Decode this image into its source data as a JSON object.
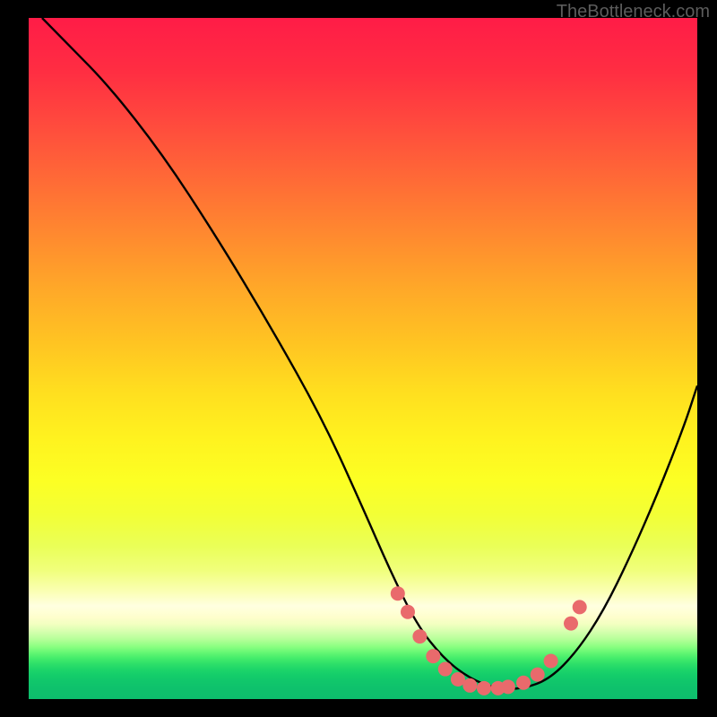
{
  "attribution": "TheBottleneck.com",
  "chart_data": {
    "type": "line",
    "title": "",
    "xlabel": "",
    "ylabel": "",
    "xlim": [
      0,
      100
    ],
    "ylim": [
      0,
      100
    ],
    "grid": false,
    "legend": false,
    "series": [
      {
        "name": "bottleneck-curve",
        "x": [
          2,
          6,
          12,
          20,
          28,
          36,
          44,
          50,
          54,
          58,
          62,
          66,
          70,
          74,
          78,
          82,
          86,
          90,
          94,
          98,
          100
        ],
        "y": [
          100,
          96,
          90,
          80,
          68,
          55,
          41,
          28,
          19,
          11,
          6,
          3,
          1.5,
          1.5,
          3,
          7,
          13,
          21,
          30,
          40,
          46
        ]
      }
    ],
    "points": {
      "name": "highlight-dots",
      "x": [
        55.2,
        56.7,
        58.5,
        60.5,
        62.3,
        64.2,
        66.0,
        68.1,
        70.2,
        71.7,
        74.0,
        76.1,
        78.1,
        81.1,
        82.4
      ],
      "y": [
        15.5,
        12.8,
        9.2,
        6.3,
        4.4,
        2.9,
        2.0,
        1.6,
        1.6,
        1.8,
        2.4,
        3.6,
        5.6,
        11.1,
        13.5
      ]
    },
    "background_gradient": {
      "top": "#ff1c47",
      "mid": "#ffe820",
      "bottom": "#0dbe6d"
    }
  }
}
